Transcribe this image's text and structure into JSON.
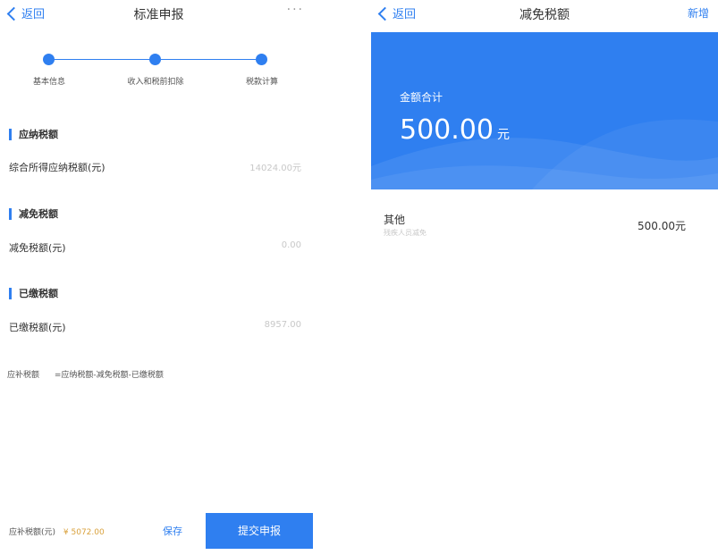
{
  "left": {
    "nav": {
      "back_label": "返回",
      "title": "标准申报",
      "more_label": "···"
    },
    "steps": [
      {
        "label": "基本信息"
      },
      {
        "label": "收入和税前扣除"
      },
      {
        "label": "税款计算"
      }
    ],
    "sections": [
      {
        "title": "应纳税额",
        "row_label": "综合所得应纳税额(元)",
        "row_value": "14024.00元"
      },
      {
        "title": "减免税额",
        "row_label": "减免税额(元)",
        "row_value": "0.00"
      },
      {
        "title": "已缴税额",
        "row_label": "已缴税额(元)",
        "row_value": "8957.00"
      }
    ],
    "formula": {
      "label": "应补税额",
      "expression": "=应纳税额-减免税额-已缴税额"
    },
    "bottom": {
      "total_label": "应补税额(元)",
      "total_value": "¥ 5072.00",
      "save_label": "保存",
      "submit_label": "提交申报"
    }
  },
  "right": {
    "nav": {
      "back_label": "返回",
      "title": "减免税额",
      "add_label": "新增"
    },
    "banner": {
      "sum_label": "金额合计",
      "sum_value": "500.00",
      "sum_unit": "元"
    },
    "items": [
      {
        "name": "其他",
        "subtitle": "残疾人员减免",
        "amount": "500.00元"
      }
    ]
  },
  "colors": {
    "accent": "#2f7ff0",
    "amount_highlight": "#d9a13c",
    "muted_text": "#c8c8c8"
  }
}
